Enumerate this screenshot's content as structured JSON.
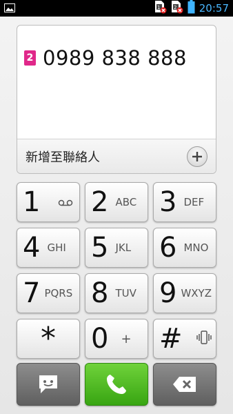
{
  "status_bar": {
    "clock": "20:57",
    "icons": [
      "gallery-icon",
      "sim1-no-signal-icon",
      "sim2-no-signal-icon",
      "battery-icon"
    ]
  },
  "dialer": {
    "sim_badge": "2",
    "number": "0989 838 888",
    "add_contact_label": "新增至聯絡人"
  },
  "keypad": [
    {
      "digit": "1",
      "letters": "",
      "icon": "voicemail-icon"
    },
    {
      "digit": "2",
      "letters": "ABC"
    },
    {
      "digit": "3",
      "letters": "DEF"
    },
    {
      "digit": "4",
      "letters": "GHI"
    },
    {
      "digit": "5",
      "letters": "JKL"
    },
    {
      "digit": "6",
      "letters": "MNO"
    },
    {
      "digit": "7",
      "letters": "PQRS"
    },
    {
      "digit": "8",
      "letters": "TUV"
    },
    {
      "digit": "9",
      "letters": "WXYZ"
    },
    {
      "digit": "*",
      "letters": ""
    },
    {
      "digit": "0",
      "letters": "+"
    },
    {
      "digit": "#",
      "letters": "",
      "icon": "vibrate-icon"
    }
  ],
  "actions": {
    "message_icon": "message-icon",
    "call_icon": "phone-icon",
    "backspace_icon": "backspace-icon"
  },
  "colors": {
    "accent_blue": "#3fb4ff",
    "sim_badge": "#e0288a",
    "call_green": "#4cbb22"
  }
}
